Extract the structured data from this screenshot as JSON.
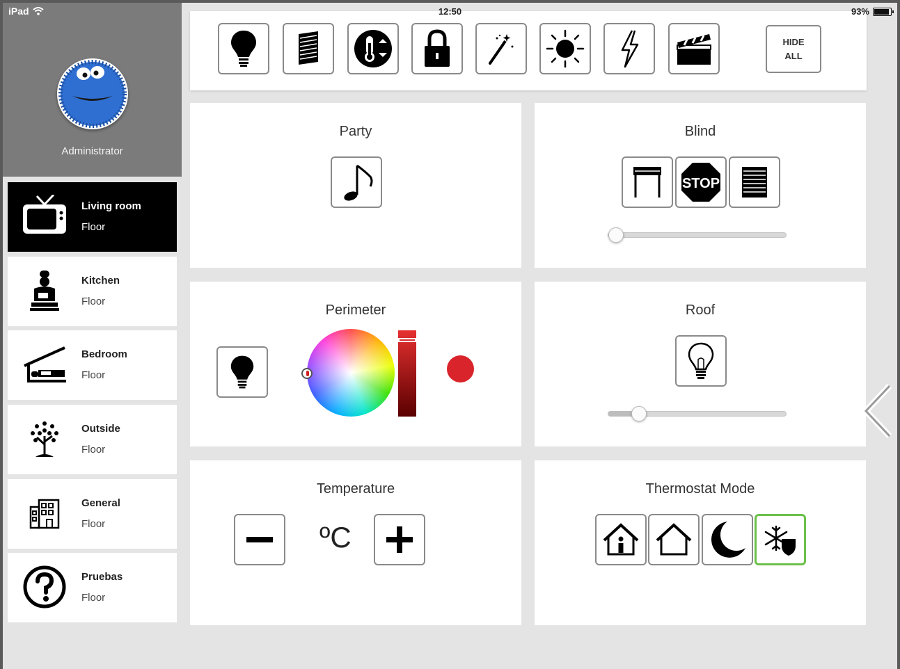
{
  "status_bar": {
    "carrier": "iPad",
    "time": "12:50",
    "battery": "93%"
  },
  "profile": {
    "name": "Administrator"
  },
  "rooms": [
    {
      "name": "Living room",
      "sub": "Floor",
      "icon": "tv-icon",
      "active": true
    },
    {
      "name": "Kitchen",
      "sub": "Floor",
      "icon": "chef-icon",
      "active": false
    },
    {
      "name": "Bedroom",
      "sub": "Floor",
      "icon": "bed-icon",
      "active": false
    },
    {
      "name": "Outside",
      "sub": "Floor",
      "icon": "tree-icon",
      "active": false
    },
    {
      "name": "General",
      "sub": "Floor",
      "icon": "building-icon",
      "active": false
    },
    {
      "name": "Pruebas",
      "sub": "Floor",
      "icon": "question-icon",
      "active": false
    }
  ],
  "toolbar": {
    "buttons": [
      "lightbulb-icon",
      "blinds-icon",
      "thermometer-icon",
      "lock-icon",
      "magic-wand-icon",
      "sun-icon",
      "lightning-icon",
      "clapperboard-icon"
    ],
    "hide_line1": "HIDE",
    "hide_line2": "ALL"
  },
  "panels": {
    "party": {
      "title": "Party"
    },
    "blind": {
      "title": "Blind",
      "stop_label": "STOP",
      "level": 0.0
    },
    "perimeter": {
      "title": "Perimeter",
      "color": "#d9242c"
    },
    "roof": {
      "title": "Roof",
      "level": 0.15
    },
    "temperature": {
      "title": "Temperature",
      "unit": "ºC"
    },
    "thermostat": {
      "title": "Thermostat Mode",
      "modes": [
        "home-info-icon",
        "home-icon",
        "moon-icon",
        "snowflake-shield-icon"
      ],
      "selected": 3
    }
  },
  "colors": {
    "accent_selected": "#6cc04a",
    "active_room_bg": "#000000",
    "color_dot": "#d9242c"
  }
}
